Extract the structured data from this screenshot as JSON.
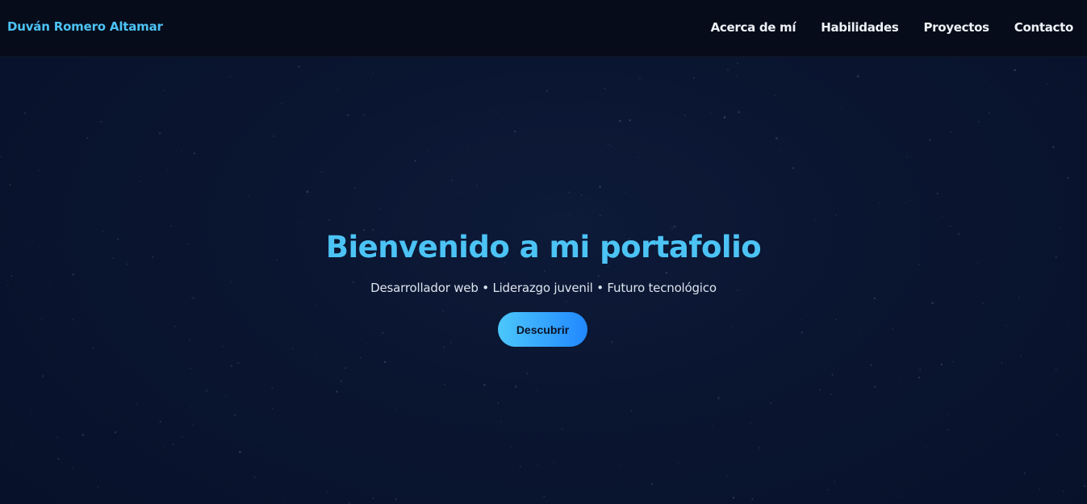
{
  "header": {
    "brand": "Duván Romero Altamar",
    "nav": [
      {
        "label": "Acerca de mí"
      },
      {
        "label": "Habilidades"
      },
      {
        "label": "Proyectos"
      },
      {
        "label": "Contacto"
      }
    ]
  },
  "hero": {
    "title": "Bienvenido a mi portafolio",
    "subtitle": "Desarrollador web • Liderazgo juvenil • Futuro tecnológico",
    "button_label": "Descubrir"
  },
  "colors": {
    "accent": "#4cc3f5",
    "background": "#0a1328",
    "nav_background": "#070c1a",
    "button_gradient_start": "#4cc7fb",
    "button_gradient_end": "#2188ff"
  }
}
